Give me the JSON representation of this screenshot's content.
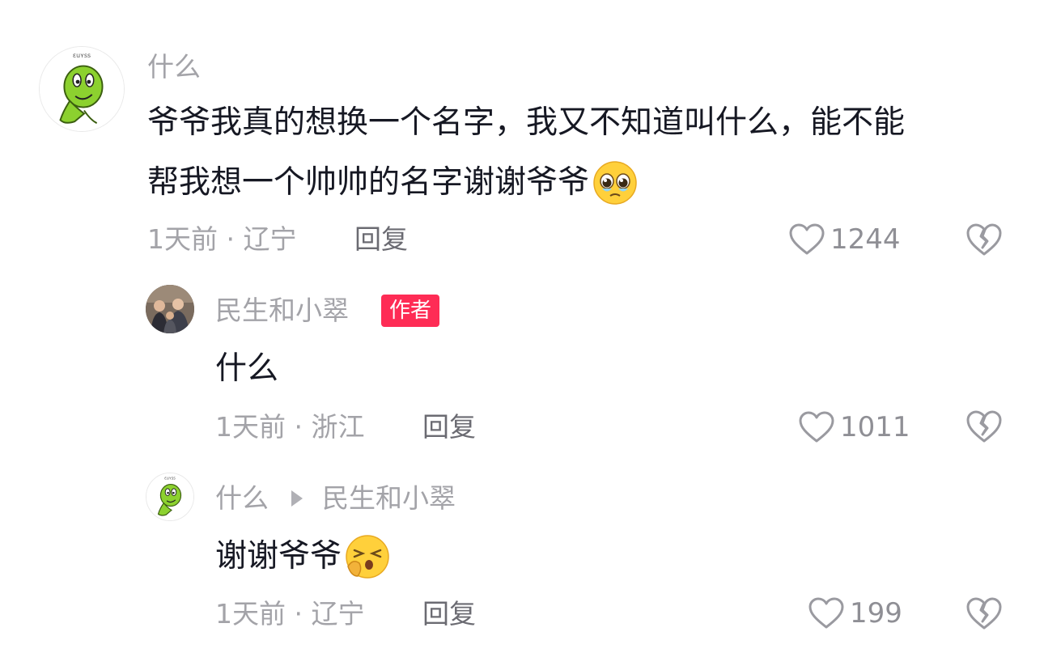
{
  "comment": {
    "author": "什么",
    "text_line1": "爷爷我真的想换一个名字，我又不知道叫什么，能不能",
    "text_line2": "帮我想一个帅帅的名字谢谢爷爷",
    "emoji": "pleading-face",
    "meta": "1天前 · 辽宁",
    "reply_label": "回复",
    "likes": "1244"
  },
  "replies": [
    {
      "author": "民生和小翠",
      "badge": "作者",
      "text": "什么",
      "meta": "1天前 · 浙江",
      "reply_label": "回复",
      "likes": "1011"
    },
    {
      "author": "什么",
      "reply_to": "民生和小翠",
      "text": "谢谢爷爷",
      "emoji": "kissing-closed-eyes-face",
      "meta": "1天前 · 辽宁",
      "reply_label": "回复",
      "likes": "199"
    }
  ],
  "colors": {
    "name": "#a3a3a8",
    "text": "#161823",
    "badge": "#fe2c55"
  }
}
